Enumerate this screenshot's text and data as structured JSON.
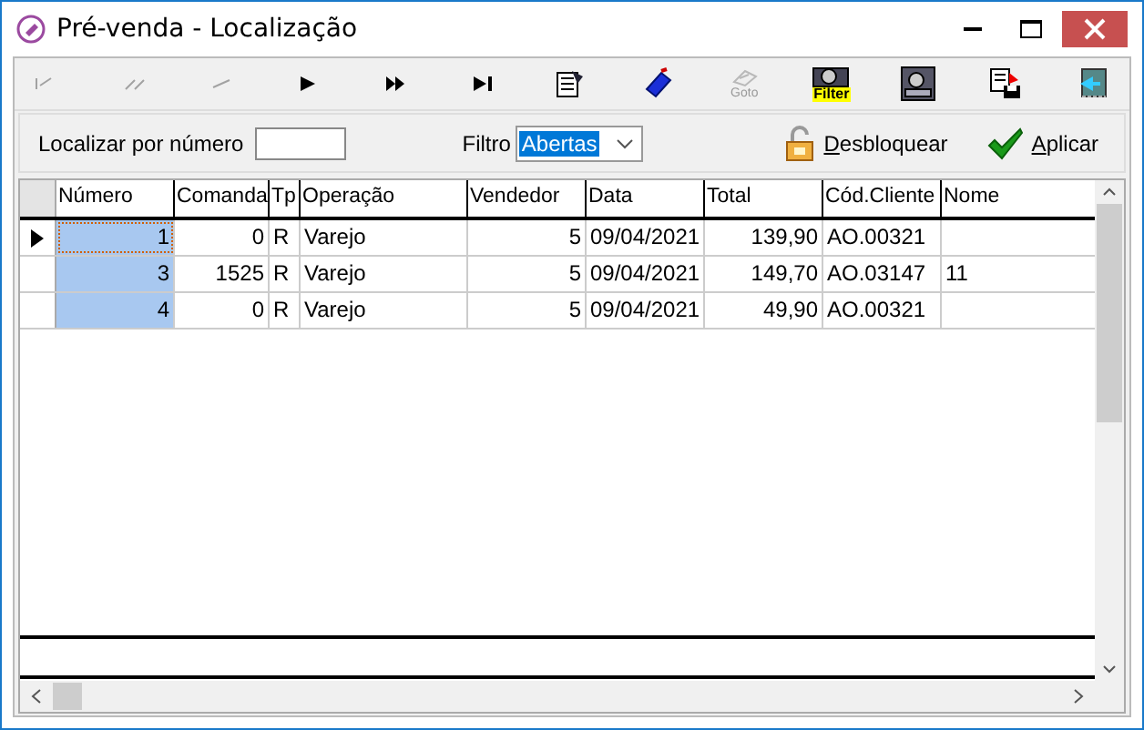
{
  "window": {
    "title": "Pré-venda - Localização"
  },
  "toolbar": [
    {
      "kind": "first",
      "disabled": true
    },
    {
      "kind": "prev-page",
      "disabled": true
    },
    {
      "kind": "prev",
      "disabled": true
    },
    {
      "kind": "next",
      "disabled": false
    },
    {
      "kind": "next-page",
      "disabled": false
    },
    {
      "kind": "last",
      "disabled": false
    },
    {
      "kind": "report",
      "disabled": false
    },
    {
      "kind": "tag",
      "disabled": false
    },
    {
      "kind": "goto",
      "label": "Goto",
      "disabled": true
    },
    {
      "kind": "filter",
      "label": "Filter",
      "disabled": false
    },
    {
      "kind": "screen",
      "disabled": false
    },
    {
      "kind": "export",
      "disabled": false
    },
    {
      "kind": "exit",
      "disabled": false
    }
  ],
  "search": {
    "label": "Localizar por número"
  },
  "filter": {
    "label": "Filtro",
    "value": "Abertas"
  },
  "buttons": [
    {
      "kind": "unlock",
      "label": "Desbloquear"
    },
    {
      "kind": "apply",
      "label": "Aplicar"
    }
  ],
  "table": {
    "columns": [
      {
        "label": "Número",
        "selected": true
      },
      {
        "label": "Comanda",
        "selected": false
      },
      {
        "label": "Tp",
        "selected": false
      },
      {
        "label": "Operação",
        "selected": false
      },
      {
        "label": "Vendedor",
        "selected": false
      },
      {
        "label": "Data",
        "selected": false
      },
      {
        "label": "Total",
        "selected": false
      },
      {
        "label": "Cód.Cliente",
        "selected": false
      },
      {
        "label": "Nome",
        "selected": false
      }
    ],
    "rows": [
      {
        "current": true,
        "cells": [
          "1",
          "0",
          "R",
          "Varejo",
          "5",
          "09/04/2021",
          "139,90",
          "AO.00321",
          ""
        ]
      },
      {
        "current": false,
        "cells": [
          "3",
          "1525",
          "R",
          "Varejo",
          "5",
          "09/04/2021",
          "149,70",
          "AO.03147",
          "11"
        ]
      },
      {
        "current": false,
        "cells": [
          "4",
          "0",
          "R",
          "Varejo",
          "5",
          "09/04/2021",
          "49,90",
          "AO.00321",
          ""
        ]
      }
    ]
  }
}
